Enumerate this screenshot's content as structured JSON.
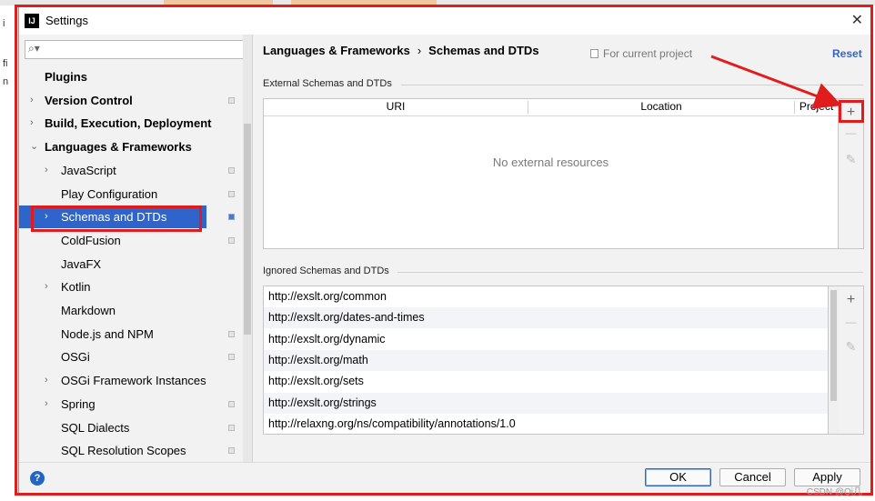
{
  "dialog": {
    "title": "Settings",
    "app_icon": "IJ",
    "close_glyph": "✕"
  },
  "search": {
    "placeholder": "",
    "icon": "search-icon"
  },
  "tree": {
    "items": [
      {
        "label": "Plugins",
        "level": 0,
        "bold": true,
        "arrow": "",
        "badge": false,
        "selected": false
      },
      {
        "label": "Version Control",
        "level": 0,
        "bold": true,
        "arrow": "›",
        "badge": true,
        "selected": false
      },
      {
        "label": "Build, Execution, Deployment",
        "level": 0,
        "bold": true,
        "arrow": "›",
        "badge": false,
        "selected": false
      },
      {
        "label": "Languages & Frameworks",
        "level": 0,
        "bold": true,
        "arrow": "⌄",
        "badge": false,
        "selected": false
      },
      {
        "label": "JavaScript",
        "level": 1,
        "bold": false,
        "arrow": "›",
        "badge": true,
        "selected": false
      },
      {
        "label": "Play Configuration",
        "level": 1,
        "bold": false,
        "arrow": "",
        "badge": true,
        "selected": false
      },
      {
        "label": "Schemas and DTDs",
        "level": 1,
        "bold": false,
        "arrow": "›",
        "badge": true,
        "selected": true
      },
      {
        "label": "ColdFusion",
        "level": 1,
        "bold": false,
        "arrow": "",
        "badge": true,
        "selected": false
      },
      {
        "label": "JavaFX",
        "level": 1,
        "bold": false,
        "arrow": "",
        "badge": false,
        "selected": false
      },
      {
        "label": "Kotlin",
        "level": 1,
        "bold": false,
        "arrow": "›",
        "badge": false,
        "selected": false
      },
      {
        "label": "Markdown",
        "level": 1,
        "bold": false,
        "arrow": "",
        "badge": false,
        "selected": false
      },
      {
        "label": "Node.js and NPM",
        "level": 1,
        "bold": false,
        "arrow": "",
        "badge": true,
        "selected": false
      },
      {
        "label": "OSGi",
        "level": 1,
        "bold": false,
        "arrow": "",
        "badge": true,
        "selected": false
      },
      {
        "label": "OSGi Framework Instances",
        "level": 1,
        "bold": false,
        "arrow": "›",
        "badge": false,
        "selected": false
      },
      {
        "label": "Spring",
        "level": 1,
        "bold": false,
        "arrow": "›",
        "badge": true,
        "selected": false
      },
      {
        "label": "SQL Dialects",
        "level": 1,
        "bold": false,
        "arrow": "",
        "badge": true,
        "selected": false
      },
      {
        "label": "SQL Resolution Scopes",
        "level": 1,
        "bold": false,
        "arrow": "",
        "badge": true,
        "selected": false
      }
    ]
  },
  "breadcrumb": {
    "parent": "Languages & Frameworks",
    "separator": "›",
    "current": "Schemas and DTDs"
  },
  "scope_note": "For current project",
  "reset_label": "Reset",
  "external": {
    "section_label": "External Schemas and DTDs",
    "columns": [
      "URI",
      "Location",
      "Project"
    ],
    "empty_text": "No external resources",
    "tools": {
      "add": "+",
      "remove": "—",
      "edit": "✎"
    }
  },
  "ignored": {
    "section_label": "Ignored Schemas and DTDs",
    "rows": [
      "http://exslt.org/common",
      "http://exslt.org/dates-and-times",
      "http://exslt.org/dynamic",
      "http://exslt.org/math",
      "http://exslt.org/sets",
      "http://exslt.org/strings",
      "http://relaxng.org/ns/compatibility/annotations/1.0"
    ],
    "tools": {
      "add": "+",
      "remove": "—",
      "edit": "✎"
    }
  },
  "buttons": {
    "help": "?",
    "ok": "OK",
    "cancel": "Cancel",
    "apply": "Apply"
  },
  "background_window": {
    "left_glyphs": [
      "i",
      "fi",
      "n"
    ]
  },
  "watermark": "CSDN @Qi几",
  "colors": {
    "accent": "#2f65ca",
    "annotation": "#e01c1c",
    "selection": "#2f65ca"
  }
}
